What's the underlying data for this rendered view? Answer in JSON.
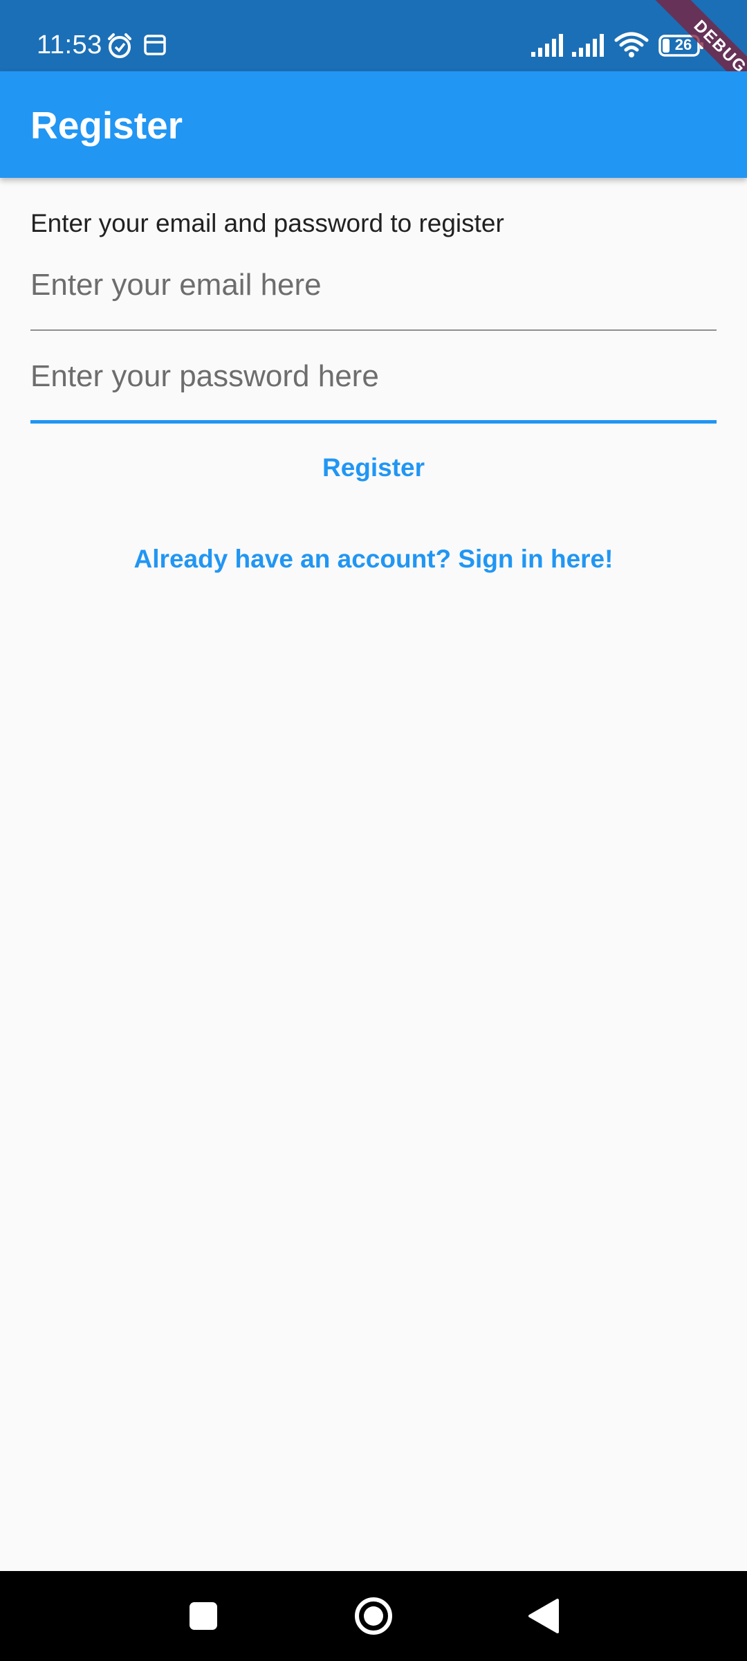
{
  "status_bar": {
    "time": "11:53",
    "battery_level": "26",
    "icons": [
      "alarm-icon",
      "sim-card-icon",
      "signal-icon",
      "signal-icon",
      "wifi-icon",
      "battery-icon"
    ]
  },
  "debug_banner": {
    "label": "DEBUG",
    "color": "#801d38"
  },
  "app_bar": {
    "title": "Register",
    "color": "#2196f3"
  },
  "form": {
    "instructions": "Enter your email and password to register",
    "email": {
      "value": "",
      "placeholder": "Enter your email here"
    },
    "password": {
      "value": "",
      "placeholder": "Enter your password here",
      "focused": true
    },
    "register_label": "Register",
    "signin_label": "Already have an account? Sign in here!"
  },
  "nav_bar": {
    "buttons": [
      "recent-apps-icon",
      "home-icon",
      "back-icon"
    ]
  },
  "colors": {
    "accent": "#2196f3",
    "status_bar": "#1b6fb6",
    "background": "#fafafa"
  }
}
